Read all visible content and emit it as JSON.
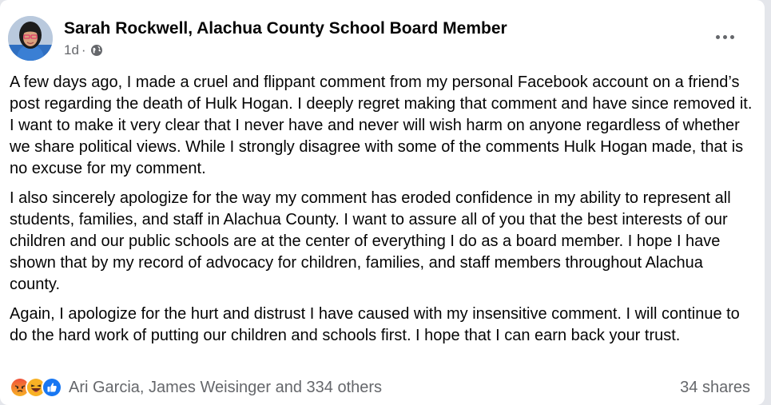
{
  "post": {
    "author": "Sarah Rockwell, Alachua County School Board Member",
    "time": "1d",
    "separator": "·",
    "visibility_icon": "globe-icon",
    "menu_icon": "more-options-icon",
    "paragraphs": [
      "A few days ago, I made a cruel and flippant comment from my personal Facebook account on a friend’s post regarding the death of Hulk Hogan. I deeply regret making that comment and have since removed it. I want to make it very clear that I never have and never will wish harm on anyone regardless of whether we share political views. While I strongly disagree with some of the comments Hulk Hogan made, that is no excuse for my comment.",
      "I also sincerely apologize for the way my comment has eroded confidence in my ability to represent all students, families, and staff in Alachua County. I want to assure all of you that the best interests of our children and our public schools are at the center of everything I do as a board member. I hope I have shown that by my record of advocacy for children, families, and staff members throughout Alachua county.",
      "Again, I apologize for the hurt and distrust I have caused with my insensitive comment. I will continue to do the hard work of putting our children and schools first. I hope that I can earn back your trust."
    ]
  },
  "footer": {
    "reaction_icons": [
      "angry-reaction-icon",
      "haha-reaction-icon",
      "like-reaction-icon"
    ],
    "reacted_by": "Ari Garcia, James Weisinger and 334 others",
    "shares": "34 shares"
  },
  "colors": {
    "card_bg": "#ffffff",
    "text_primary": "#050505",
    "text_secondary": "#65676b",
    "like_blue": "#1877f2",
    "angry_orange": "#e9710f",
    "haha_yellow": "#f7b125"
  }
}
